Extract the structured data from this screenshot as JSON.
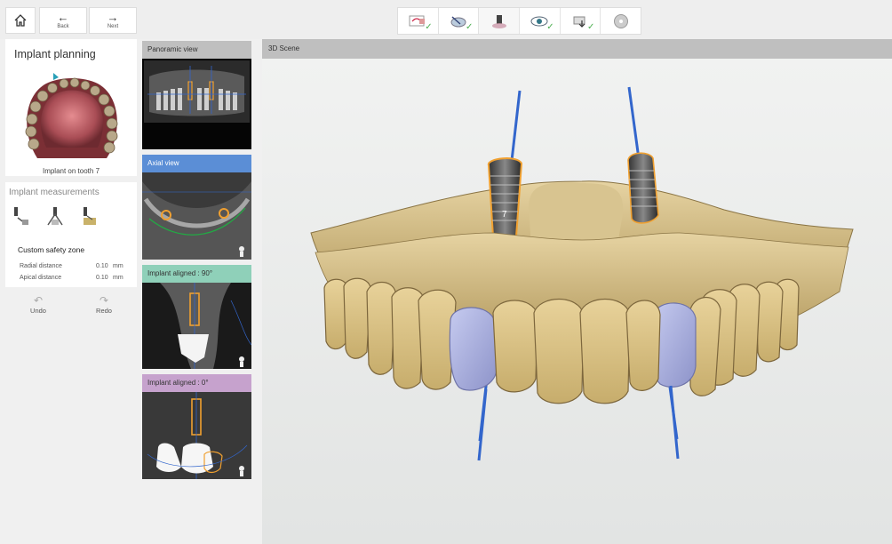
{
  "toolbar": {
    "back_label": "Back",
    "next_label": "Next",
    "workflow_steps": [
      {
        "icon": "scan-data-icon",
        "done": true
      },
      {
        "icon": "model-align-icon",
        "done": true
      },
      {
        "icon": "implant-planning-icon",
        "done": false,
        "active": true
      },
      {
        "icon": "review-eye-icon",
        "done": true
      },
      {
        "icon": "guide-design-icon",
        "done": true
      },
      {
        "icon": "export-disc-icon",
        "done": false
      }
    ],
    "check_glyph": "✓"
  },
  "left_panel": {
    "planning_title": "Implant planning",
    "arch_caption": "Implant on tooth 7",
    "measurements_title": "Implant measurements",
    "safety_zone_title": "Custom safety zone",
    "radial_label": "Radial distance",
    "radial_value": "0.10",
    "radial_unit": "mm",
    "apical_label": "Apical distance",
    "apical_value": "0.10",
    "apical_unit": "mm",
    "undo_label": "Undo",
    "redo_label": "Redo"
  },
  "views": {
    "panoramic": {
      "title": "Panoramic view",
      "color": "#bfbfbf"
    },
    "axial": {
      "title": "Axial view",
      "color": "#5b8ed6"
    },
    "aligned_90": {
      "title": "Implant aligned : 90°",
      "color": "#8fd0b9"
    },
    "aligned_0": {
      "title": "Implant aligned : 0°",
      "color": "#c6a2cd"
    }
  },
  "scene": {
    "title": "3D Scene",
    "implant_label": "7"
  },
  "colors": {
    "implant_orange": "#f0a030",
    "axis_blue": "#3366cc",
    "model_tan": "#d6bd85",
    "crown_lavender": "#a8aee0"
  }
}
